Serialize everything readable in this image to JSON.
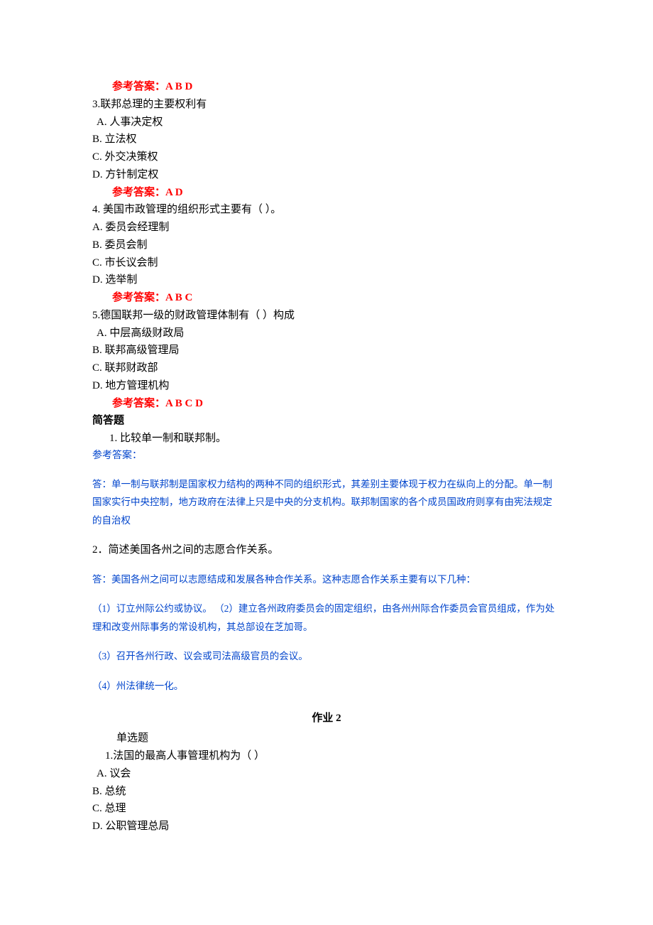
{
  "q2": {
    "answer": "参考答案：A B D"
  },
  "q3": {
    "text": "3.联邦总理的主要权利有",
    "a": "A.  人事决定权",
    "b": "B.  立法权",
    "c": "C.  外交决策权",
    "d": "D.  方针制定权",
    "answer": "参考答案：A D"
  },
  "q4": {
    "text": "4.   美国市政管理的组织形式主要有（           ）。",
    "a": "A.  委员会经理制",
    "b": "B.  委员会制",
    "c": "C.  市长议会制",
    "d": "D.  选举制",
    "answer": "参考答案：A B C"
  },
  "q5": {
    "text": "5.德国联邦一级的财政管理体制有（    ）构成",
    "a": "A.  中层高级财政局",
    "b": "B.  联邦高级管理局",
    "c": "C.  联邦财政部",
    "d": "D.  地方管理机构",
    "answer": "参考答案：A B C D"
  },
  "short_answer": {
    "heading": "简答题",
    "q1": {
      "text": "1.   比较单一制和联邦制。",
      "label": "参考答案：",
      "answer": "答：单一制与联邦制是国家权力结构的两种不同的组织形式，其差别主要体现于权力在纵向上的分配。单一制国家实行中央控制，地方政府在法律上只是中央的分支机构。联邦制国家的各个成员国政府则享有由宪法规定的自治权"
    },
    "q2": {
      "text": "2．简述美国各州之间的志愿合作关系。",
      "answer1": "答：美国各州之间可以志愿结成和发展各种合作关系。这种志愿合作关系主要有以下几种：",
      "answer2": "（1）订立州际公约或协议。             （2）建立各州政府委员会的固定组织，由各州州际合作委员会官员组成，作为处理和改变州际事务的常设机构，其总部设在芝加哥。",
      "answer3": "（3）召开各州行政、议会或司法高级官员的会议。",
      "answer4": "（4）州法律统一化。"
    }
  },
  "hw2": {
    "title": "作业 2",
    "section": "单选题",
    "q1": {
      "text": "1.法国的最高人事管理机构为（  ）",
      "a": "A.  议会",
      "b": "B.  总统",
      "c": "C.  总理",
      "d": "D.  公职管理总局"
    }
  }
}
